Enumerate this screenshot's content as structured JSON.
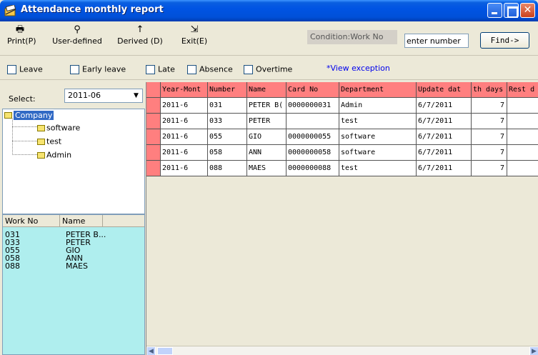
{
  "window": {
    "title": "Attendance monthly report"
  },
  "toolbar": {
    "print_label": "Print(P)",
    "user_defined_label": "User-defined",
    "derived_label": "Derived (D)",
    "exit_label": "Exit(E)",
    "condition_label": "Condition:Work No",
    "search_value": "enter number",
    "find_label": "Find->"
  },
  "filters": {
    "leave": "Leave",
    "early_leave": "Early leave",
    "late": "Late",
    "absence": "Absence",
    "overtime": "Overtime",
    "view_exception": "*View exception"
  },
  "select": {
    "label": "Select:",
    "value": "2011-06"
  },
  "tree": {
    "root": "Company",
    "children": [
      "software",
      "test",
      "Admin"
    ]
  },
  "employees": {
    "headers": [
      "Work No",
      "Name"
    ],
    "rows": [
      [
        "031",
        "PETER B..."
      ],
      [
        "033",
        "PETER"
      ],
      [
        "055",
        "GIO"
      ],
      [
        "058",
        "ANN"
      ],
      [
        "088",
        "MAES"
      ]
    ]
  },
  "grid": {
    "headers": [
      "Year-Mont",
      "Number",
      "Name",
      "Card No",
      "Department",
      "Update dat",
      "th days",
      "Rest d"
    ],
    "rows": [
      [
        "2011-6",
        "031",
        "PETER B(",
        "0000000031",
        "Admin",
        "6/7/2011",
        "7",
        ""
      ],
      [
        "2011-6",
        "033",
        "PETER",
        "",
        "test",
        "6/7/2011",
        "7",
        ""
      ],
      [
        "2011-6",
        "055",
        "GIO",
        "0000000055",
        "software",
        "6/7/2011",
        "7",
        ""
      ],
      [
        "2011-6",
        "058",
        "ANN",
        "0000000058",
        "software",
        "6/7/2011",
        "7",
        ""
      ],
      [
        "2011-6",
        "088",
        "MAES",
        "0000000088",
        "test",
        "6/7/2011",
        "7",
        ""
      ]
    ]
  },
  "colors": {
    "header_bg": "#ff7f7f",
    "list_bg": "#afeeee",
    "titlebar": "#0054e3"
  }
}
